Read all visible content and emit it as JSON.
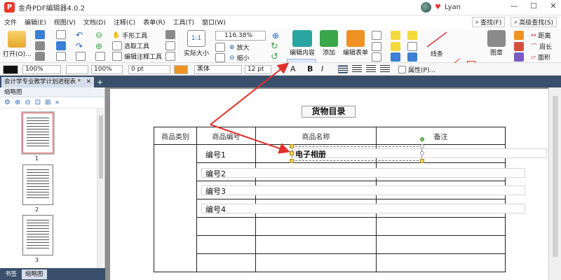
{
  "app": {
    "title": "金舟PDF编辑器4.0.2",
    "user": "Lyan"
  },
  "menu": [
    "文件",
    "编辑(E)",
    "视图(V)",
    "文档(D)",
    "注释(C)",
    "表单(R)",
    "工具(T)",
    "窗口(W)"
  ],
  "menu_right": {
    "find": "查找(F)",
    "advanced_find": "高级查找(S)"
  },
  "ribbon": {
    "open": "打开(O)...",
    "hand_tool": "手形工具",
    "select_tool": "选取工具",
    "annotate_tool": "编辑注释工具",
    "actual_size": "实际大小",
    "zoom_value": "116.38%",
    "zoom_in": "放大",
    "zoom_out": "缩小",
    "edit_content": "编辑内容",
    "add": "添加",
    "edit_form": "编辑表单",
    "line": "线条",
    "stamp": "图章",
    "distance": "距离",
    "perimeter": "周长",
    "area": "面积"
  },
  "format": {
    "fill_opacity": "100%",
    "stroke_opacity": "100%",
    "line_width": "0 pt",
    "font": "黑体",
    "font_size": "12 pt",
    "bold": "B",
    "italic": "I",
    "properties": "属性(P)..."
  },
  "tabs": {
    "doc_tab": "会计学专业教学计划进程表 *"
  },
  "panel": {
    "title": "缩略图",
    "thumbs": [
      "1",
      "2",
      "3"
    ],
    "bottom_tabs": [
      "书签",
      "缩略图"
    ]
  },
  "document": {
    "title": "货物目录",
    "headers": [
      "商品类别",
      "商品编号",
      "商品名称",
      "备注"
    ],
    "rows": [
      "编号1",
      "编号2",
      "编号3",
      "编号4"
    ],
    "edited_text": "电子相册"
  }
}
